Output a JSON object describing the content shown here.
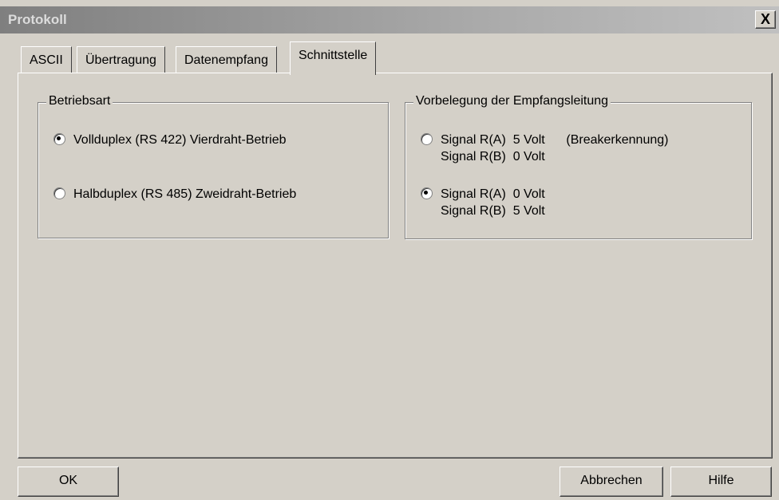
{
  "window": {
    "title": "Protokoll",
    "close_label": "X"
  },
  "tabs": [
    {
      "label": "ASCII",
      "active": false
    },
    {
      "label": "Übertragung",
      "active": false
    },
    {
      "label": "Datenempfang",
      "active": false
    },
    {
      "label": "Schnittstelle",
      "active": true
    }
  ],
  "betriebsart": {
    "legend": "Betriebsart",
    "options": [
      {
        "label": "Vollduplex (RS 422) Vierdraht-Betrieb",
        "checked": true
      },
      {
        "label": "Halbduplex (RS 485) Zweidraht-Betrieb",
        "checked": false
      }
    ]
  },
  "vorbelegung": {
    "legend": "Vorbelegung der Empfangsleitung",
    "options": [
      {
        "line1": "Signal R(A)  5 Volt      (Breakerkennung)",
        "line2": "Signal R(B)  0 Volt",
        "checked": false
      },
      {
        "line1": "Signal R(A)  0 Volt",
        "line2": "Signal R(B)  5 Volt",
        "checked": true
      }
    ]
  },
  "buttons": {
    "ok": "OK",
    "cancel": "Abbrechen",
    "help": "Hilfe"
  }
}
